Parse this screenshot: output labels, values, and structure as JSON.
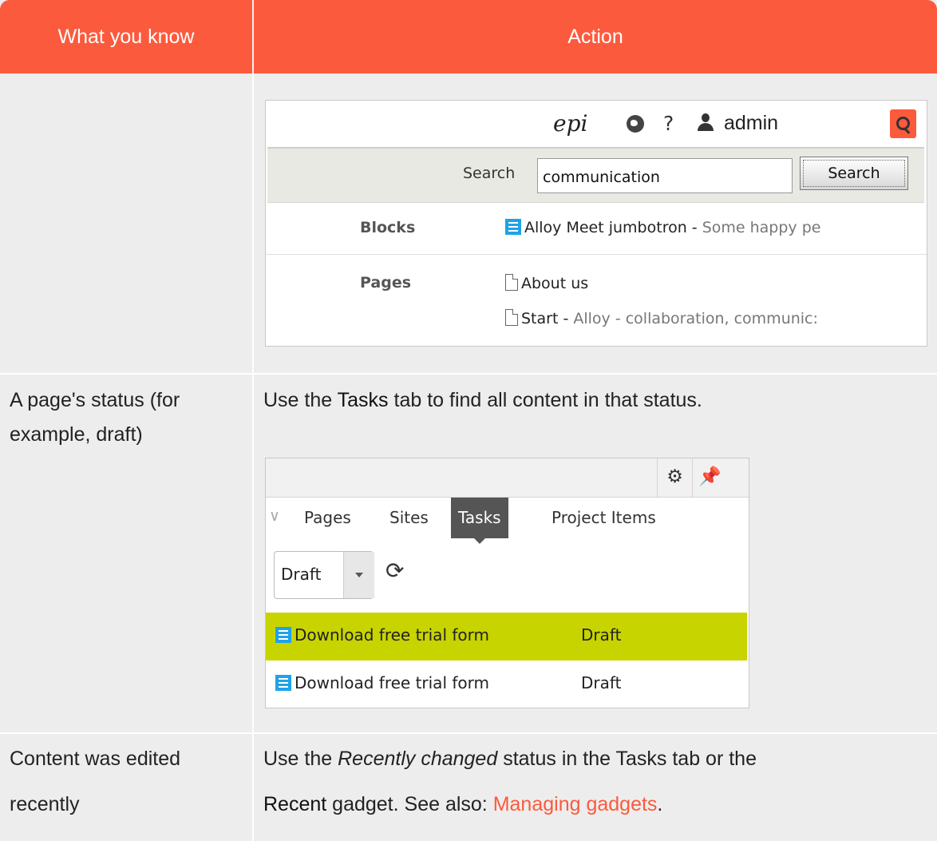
{
  "header": {
    "col1": "What you know",
    "col2": "Action"
  },
  "rows": [
    {
      "left": "",
      "screenshot": {
        "logo": "epi",
        "help": "?",
        "user": "admin",
        "search_label": "Search",
        "search_value": "communication",
        "search_button": "Search",
        "results": [
          {
            "label": "Blocks",
            "items": [
              {
                "title": "Alloy Meet jumbotron",
                "sep": " - ",
                "desc": "Some happy pe"
              }
            ]
          },
          {
            "label": "Pages",
            "items": [
              {
                "title": "About us",
                "sep": "",
                "desc": ""
              },
              {
                "title": "Start",
                "sep": " - ",
                "desc": "Alloy - collaboration, communic:"
              }
            ]
          }
        ]
      }
    },
    {
      "left_line1": "A page's status (for",
      "left_line2": "example, draft)",
      "right_pre": "Use the ",
      "right_bold": "Tasks",
      "right_post": " tab to find all content in that status.",
      "screenshot": {
        "tabs": [
          "Pages",
          "Sites",
          "Tasks",
          "Project Items"
        ],
        "active_tab": "Tasks",
        "filter": "Draft",
        "tasks": [
          {
            "name": "Download free trial form",
            "status": "Draft",
            "selected": true
          },
          {
            "name": "Download free trial form",
            "status": "Draft",
            "selected": false
          }
        ]
      }
    },
    {
      "left_line1": "Content was edited",
      "left_line2": "recently",
      "r1_pre": "Use the ",
      "r1_italic": "Recently changed",
      "r1_post": " status in the Tasks tab or the",
      "r2_bold": "Recent",
      "r2_mid": " gadget. See also: ",
      "r2_link": "Managing gadgets",
      "r2_end": "."
    }
  ],
  "icons": [
    "globe-icon",
    "help-icon",
    "user-icon",
    "search-icon",
    "block-icon",
    "page-icon",
    "gear-icon",
    "pin-icon",
    "chevron-icon",
    "dropdown-icon",
    "refresh-icon"
  ],
  "colors": {
    "header": "#fc5a3d",
    "selected_row": "#c8d400",
    "block_icon": "#1ea3e8"
  }
}
